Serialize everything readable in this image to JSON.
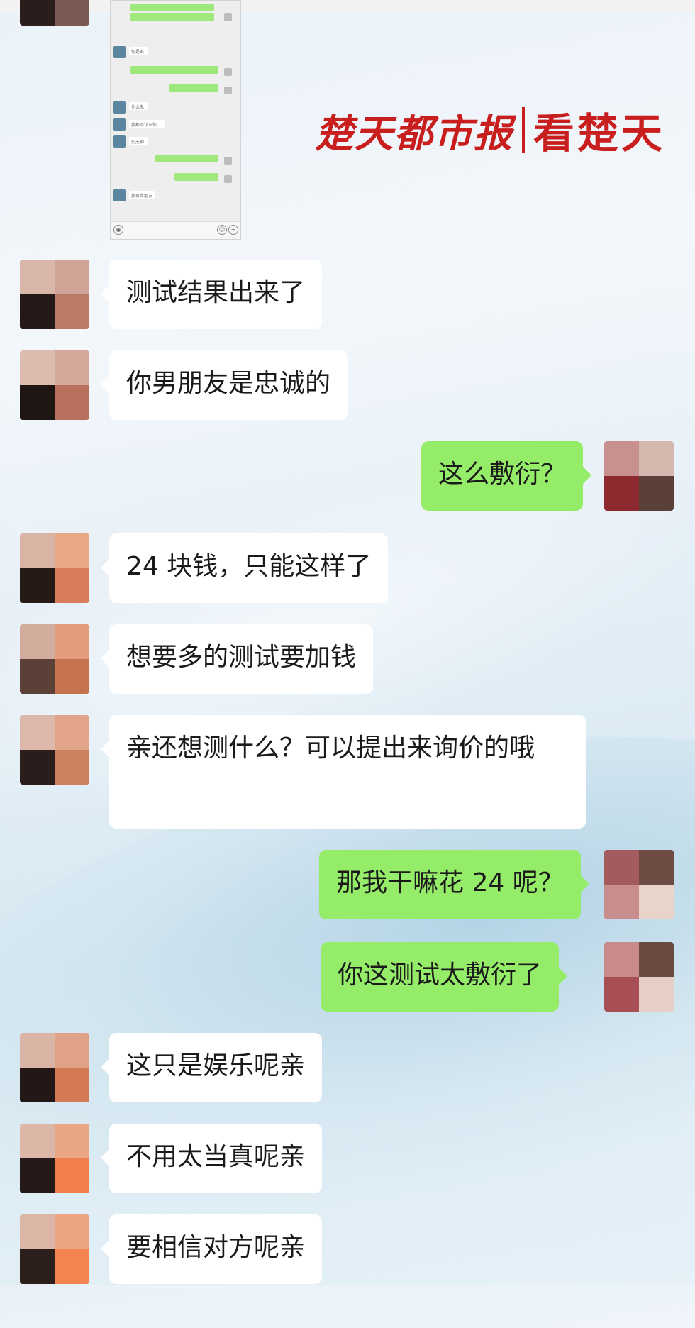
{
  "watermark": {
    "left": "楚天都市报",
    "right": "看楚天"
  },
  "embedded_screenshot": {
    "snippets": [
      "你是谁",
      "什么鬼",
      "我都不认识你",
      "别无聊",
      "我有女朋友"
    ]
  },
  "messages": [
    {
      "side": "left",
      "text": "测试结果出来了"
    },
    {
      "side": "left",
      "text": "你男朋友是忠诚的"
    },
    {
      "side": "right",
      "text": "这么敷衍？"
    },
    {
      "side": "left",
      "text": "24 块钱，只能这样了"
    },
    {
      "side": "left",
      "text": "想要多的测试要加钱"
    },
    {
      "side": "left",
      "text": "亲还想测什么？可以提出来询价的哦"
    },
    {
      "side": "right",
      "text": "那我干嘛花 24 呢？"
    },
    {
      "side": "right",
      "text": "你这测试太敷衍了"
    },
    {
      "side": "left",
      "text": "这只是娱乐呢亲"
    },
    {
      "side": "left",
      "text": "不用太当真呢亲"
    },
    {
      "side": "left",
      "text": "要相信对方呢亲"
    }
  ],
  "colors": {
    "bubble_sent": "#95ec69",
    "bubble_received": "#ffffff",
    "watermark": "#c81e1e"
  }
}
